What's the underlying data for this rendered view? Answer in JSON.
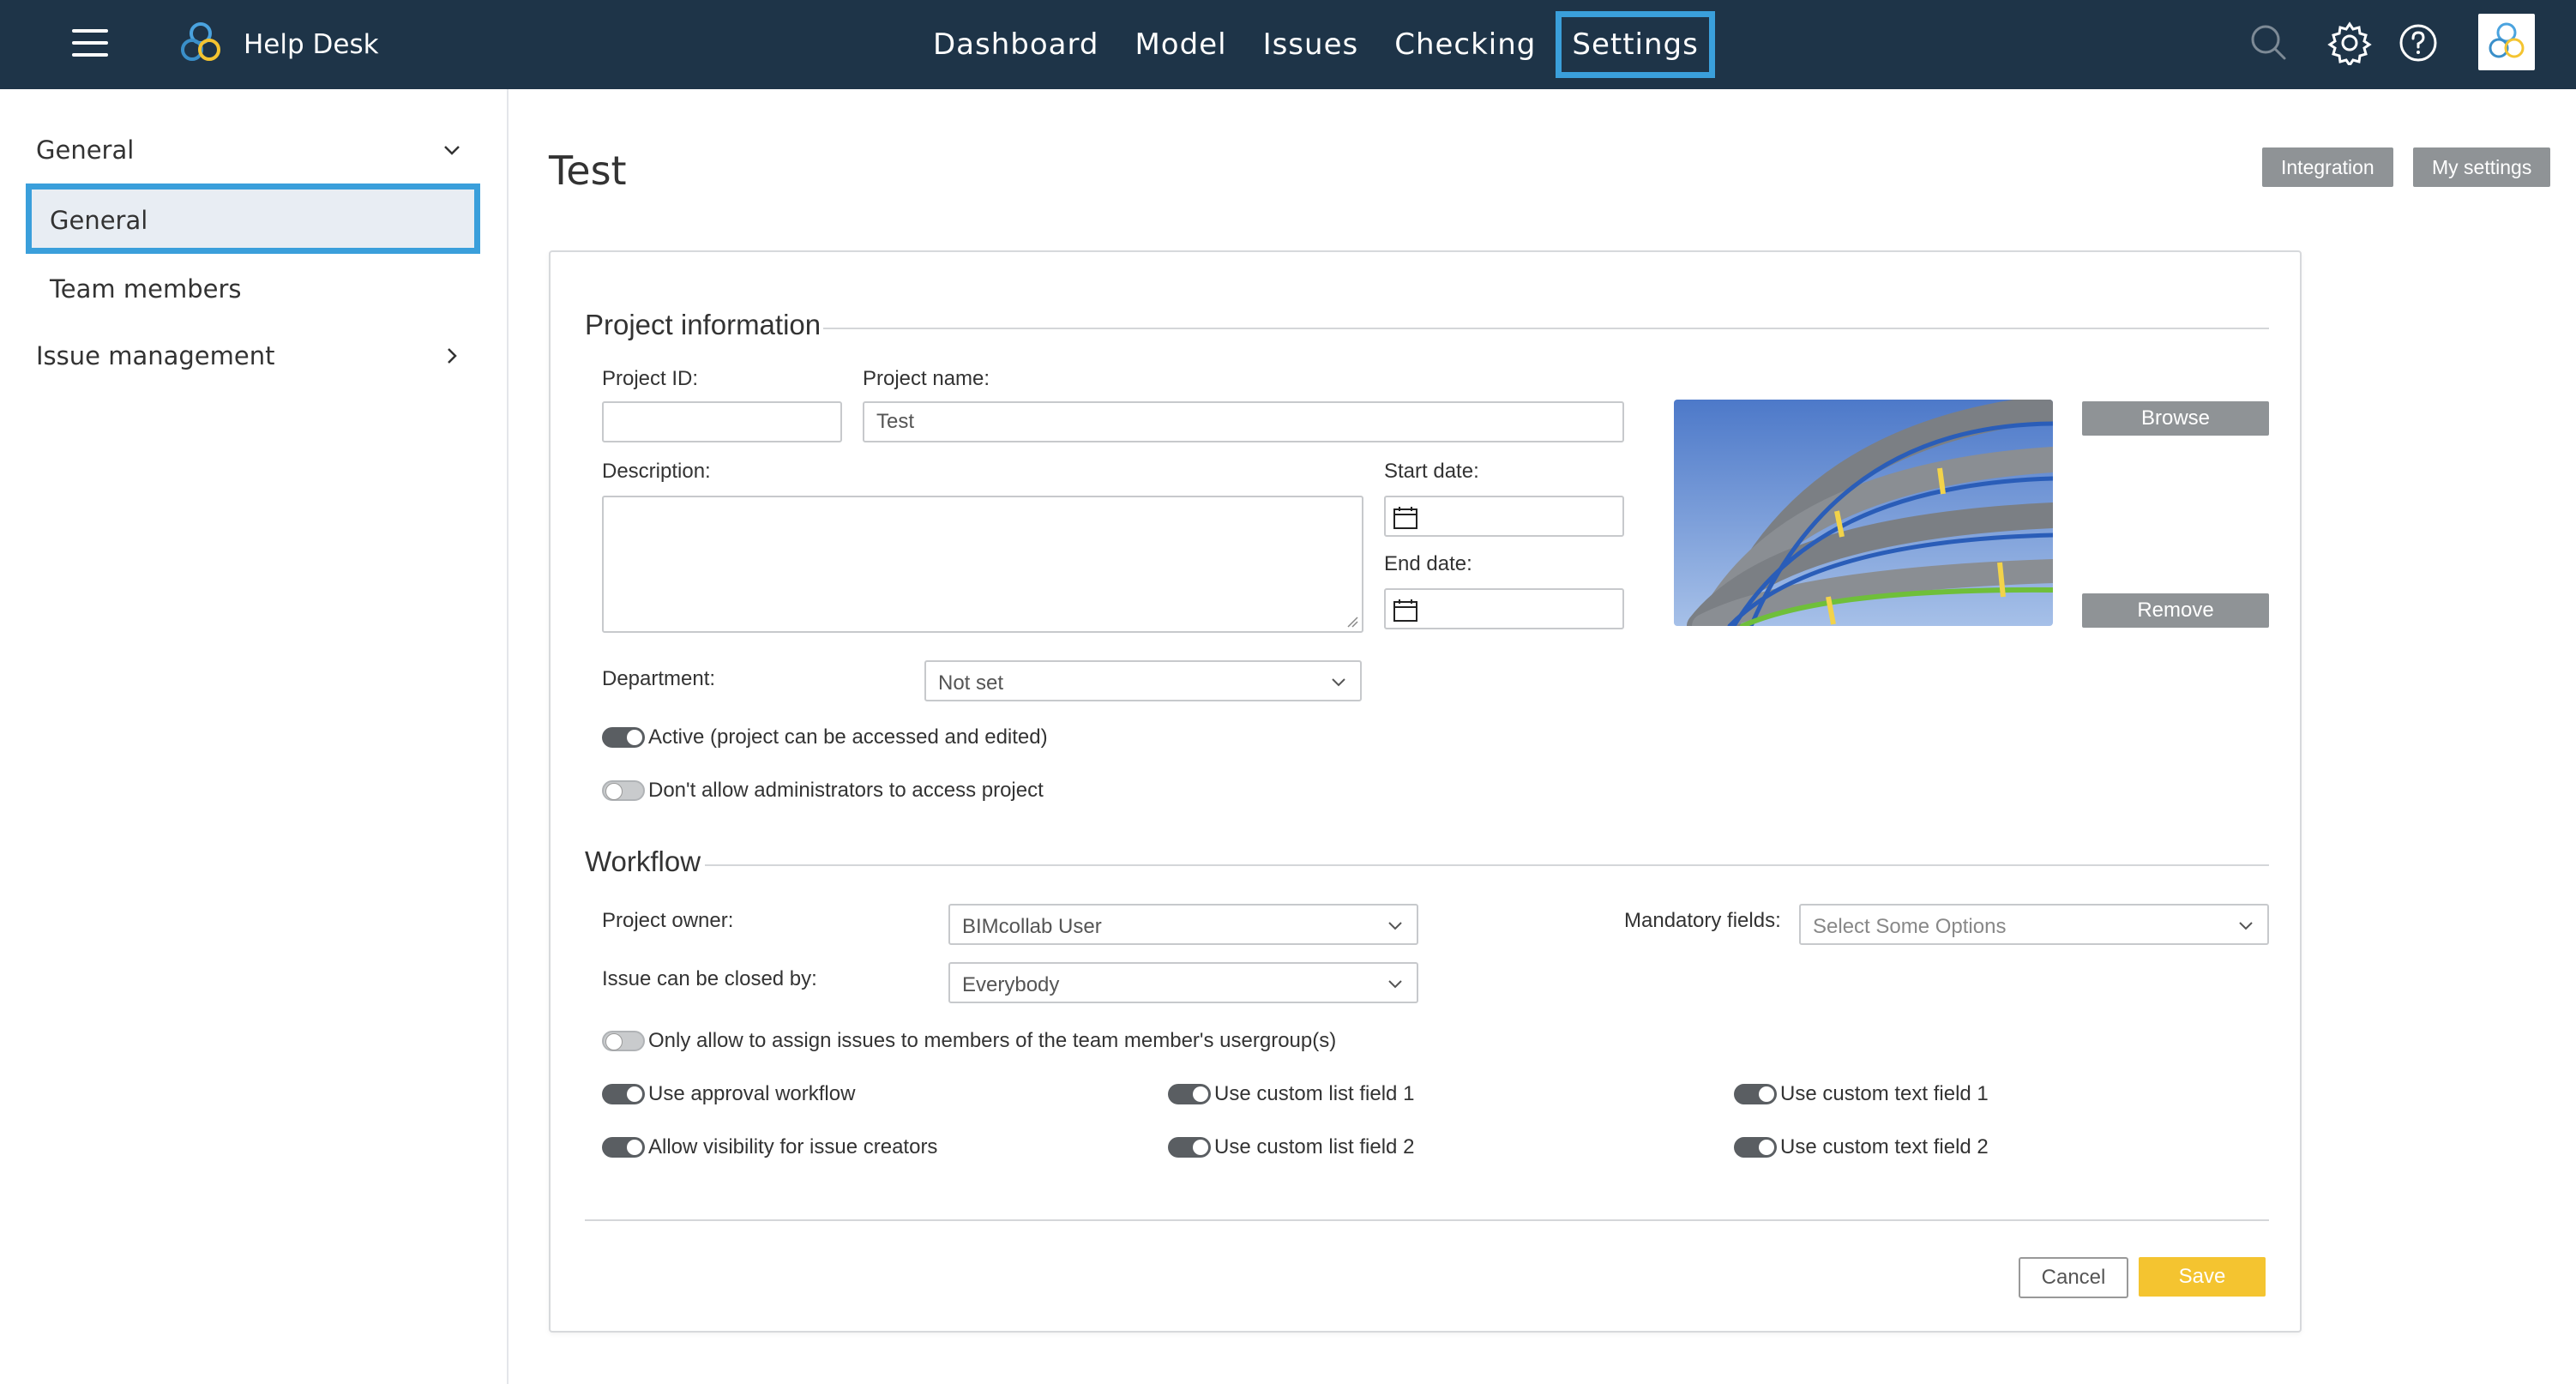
{
  "topbar": {
    "app_name": "Help Desk",
    "nav": [
      {
        "label": "Dashboard",
        "active": false
      },
      {
        "label": "Model",
        "active": false
      },
      {
        "label": "Issues",
        "active": false
      },
      {
        "label": "Checking",
        "active": false
      },
      {
        "label": "Settings",
        "active": true
      }
    ],
    "icons": [
      "search-icon",
      "gear-icon",
      "help-icon",
      "avatar"
    ]
  },
  "sidebar": {
    "group_general": "General",
    "items": [
      {
        "label": "General",
        "active": true
      },
      {
        "label": "Team members",
        "active": false
      }
    ],
    "group_issue": "Issue management"
  },
  "page": {
    "title": "Test",
    "integration_label": "Integration",
    "my_settings_label": "My settings"
  },
  "project_info": {
    "section_title": "Project information",
    "project_id_label": "Project ID:",
    "project_id_value": "",
    "project_name_label": "Project name:",
    "project_name_value": "Test",
    "description_label": "Description:",
    "description_value": "",
    "start_date_label": "Start date:",
    "end_date_label": "End date:",
    "browse_label": "Browse",
    "remove_label": "Remove",
    "department_label": "Department:",
    "department_value": "Not set",
    "active_label": "Active (project can be accessed and edited)",
    "active_on": true,
    "no_admin_label": "Don't allow administrators to access project",
    "no_admin_on": false
  },
  "workflow": {
    "section_title": "Workflow",
    "owner_label": "Project owner:",
    "owner_value": "BIMcollab User",
    "closed_by_label": "Issue can be closed by:",
    "closed_by_value": "Everybody",
    "mandatory_label": "Mandatory fields:",
    "mandatory_placeholder": "Select Some Options",
    "only_assign_label": "Only allow to assign issues to members of the team member's usergroup(s)",
    "toggles": {
      "approval": "Use approval workflow",
      "visibility": "Allow visibility for issue creators",
      "list1": "Use custom list field 1",
      "list2": "Use custom list field 2",
      "text1": "Use custom text field 1",
      "text2": "Use custom text field 2"
    }
  },
  "footer": {
    "cancel_label": "Cancel",
    "save_label": "Save"
  },
  "colors": {
    "topbar": "#1e3448",
    "highlight": "#3a9fdb",
    "save": "#f4c430",
    "gray_button": "#8f9396"
  }
}
